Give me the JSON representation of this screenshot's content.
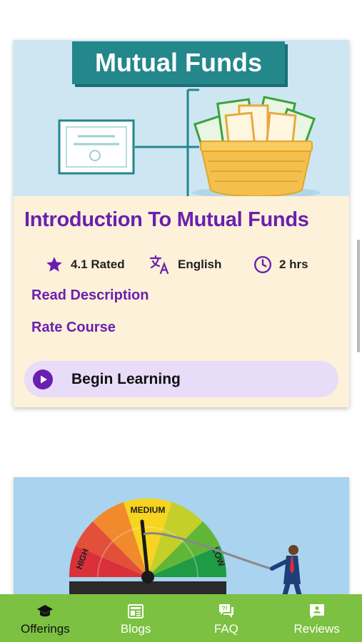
{
  "card1": {
    "banner_title": "Mutual Funds",
    "course_title": "Introduction To Mutual Funds",
    "rating": "4.1 Rated",
    "language": "English",
    "duration": "2 hrs",
    "read_description": "Read Description",
    "rate_course": "Rate Course",
    "begin_learning": "Begin Learning"
  },
  "card2": {
    "gauge_medium": "MEDIUM",
    "gauge_high": "HIGH",
    "gauge_low": "LOW"
  },
  "nav": {
    "items": [
      {
        "label": "Offerings",
        "icon": "graduation-cap-icon",
        "active": true
      },
      {
        "label": "Blogs",
        "icon": "newspaper-icon",
        "active": false
      },
      {
        "label": "FAQ",
        "icon": "faq-icon",
        "active": false
      },
      {
        "label": "Reviews",
        "icon": "review-icon",
        "active": false
      }
    ]
  },
  "colors": {
    "accent_purple": "#6a1fb0",
    "nav_green": "#7cc142",
    "card_bg": "#fdf1d9",
    "banner_teal": "#23878c"
  }
}
